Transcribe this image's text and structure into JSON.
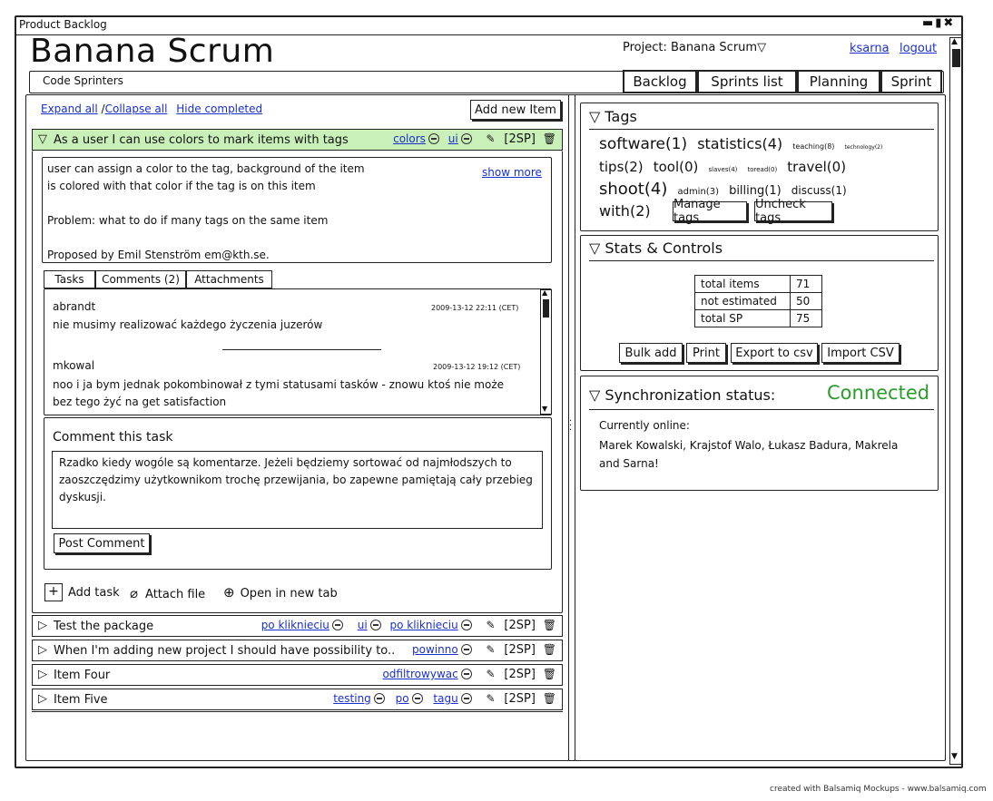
{
  "window": {
    "title": "Product Backlog"
  },
  "app": {
    "title": "Banana Scrum",
    "team": "Code Sprinters"
  },
  "header": {
    "project_label": "Project: Banana Scrum",
    "user": "ksarna",
    "logout": "logout"
  },
  "nav": {
    "tabs": [
      "Backlog",
      "Sprints list",
      "Planning",
      "Sprint"
    ],
    "active": "Planning"
  },
  "toolbar": {
    "expand_all": "Expand all",
    "separator": "/",
    "collapse_all": "Collapse all",
    "hide_completed": "Hide completed",
    "add_item": "Add new Item"
  },
  "expanded_item": {
    "title": "As a user I can use colors to mark items with tags",
    "tags": [
      "colors",
      "ui"
    ],
    "estimate": "[2SP]",
    "description": [
      "user can assign a color to the tag, background of the item",
      "is colored with that color if the tag is on this item",
      "",
      "Problem: what to do if many tags on the same item",
      "",
      "Proposed by Emil Stenström em@kth.se."
    ],
    "show_more": "show more",
    "tabs": [
      "Tasks",
      "Comments (2)",
      "Attachments"
    ],
    "comments": [
      {
        "author": "abrandt",
        "date": "2009-13-12 22:11 (CET)",
        "text": "nie musimy realizować każdego życzenia juzerów"
      },
      {
        "author": "mkowal",
        "date": "2009-13-12 19:12 (CET)",
        "text": "noo i ja bym jednak pokombinował z tymi statusami tasków - znowu ktoś nie może bez tego żyć na get satisfaction"
      }
    ],
    "comment_form": {
      "heading": "Comment this task",
      "value": "Rzadko kiedy wogóle są komentarze. Jeżeli będziemy sortować od najmłodszych to zaoszczędzimy użytkownikom trochę przewijania, bo zapewne pamiętają cały przebieg dyskusji.",
      "submit": "Post Comment"
    },
    "actions": {
      "add_task": "Add task",
      "attach_file": "Attach file",
      "open_tab": "Open in new tab"
    }
  },
  "items": [
    {
      "title": "Test the package",
      "tags": [
        "po kliknieciu",
        "ui",
        "po kliknieciu"
      ],
      "estimate": "[2SP]"
    },
    {
      "title": "When I'm adding new project I should have possibility to..",
      "tags": [
        "powinno"
      ],
      "estimate": "[2SP]"
    },
    {
      "title": "Item Four",
      "tags": [
        "odfiltrowywac"
      ],
      "estimate": "[2SP]"
    },
    {
      "title": "Item Five",
      "tags": [
        "testing",
        "po",
        "tagu"
      ],
      "estimate": "[2SP]"
    }
  ],
  "tags_panel": {
    "title": "Tags",
    "tags": [
      {
        "label": "software(1)",
        "size": 17
      },
      {
        "label": "statistics(4)",
        "size": 16
      },
      {
        "label": "teaching(8)",
        "size": 8
      },
      {
        "label": "technology(2)",
        "size": 6
      },
      {
        "label": "tips(2)",
        "size": 15
      },
      {
        "label": "tool(0)",
        "size": 15
      },
      {
        "label": "slaves(4)",
        "size": 7
      },
      {
        "label": "toread(0)",
        "size": 7
      },
      {
        "label": "travel(0)",
        "size": 15
      },
      {
        "label": "shoot(4)",
        "size": 18
      },
      {
        "label": "admin(3)",
        "size": 10
      },
      {
        "label": "billing(1)",
        "size": 13
      },
      {
        "label": "discuss(1)",
        "size": 12
      },
      {
        "label": "with(2)",
        "size": 16
      }
    ],
    "manage": "Manage tags",
    "uncheck": "Uncheck tags"
  },
  "stats_panel": {
    "title": "Stats & Controls",
    "rows": [
      {
        "label": "total items",
        "value": "71"
      },
      {
        "label": "not estimated",
        "value": "50"
      },
      {
        "label": "total SP",
        "value": "75"
      }
    ],
    "buttons": [
      "Bulk add",
      "Print",
      "Export to csv",
      "Import CSV"
    ]
  },
  "sync_panel": {
    "title": "Synchronization status:",
    "status": "Connected",
    "online_label": "Currently online:",
    "online_users": "Marek Kowalski, Krajstof Walo, Łukasz Badura, Makrela and Sarna!"
  },
  "footer": {
    "credit": "created with Balsamiq Mockups - www.balsamiq.com"
  },
  "colors": {
    "accent_green": "#c8f0b8",
    "connected": "#2a9d2a",
    "link": "#1a2fd0"
  }
}
